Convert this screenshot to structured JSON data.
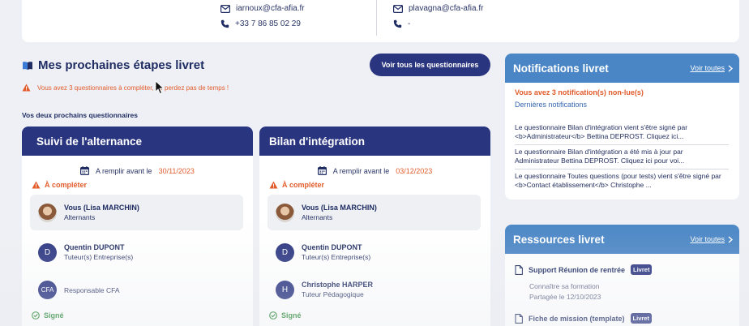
{
  "contacts": {
    "left": {
      "email": "iarnoux@cfa-afia.fr",
      "phone": "+33 7 86 85 02 29"
    },
    "right": {
      "email": "plavagna@cfa-afia.fr",
      "phone": "-"
    }
  },
  "section": {
    "title": "Mes prochaines étapes livret",
    "view_all_label": "Voir tous les questionnaires",
    "warning": "Vous avez 3 questionnaires à compléter, ne perdez pas de temps !",
    "subtitle": "Vos deux prochains questionnaires"
  },
  "questionnaires": [
    {
      "title": "Suivi de l'alternance",
      "date_label": "A remplir avant le",
      "date": "30/11/2023",
      "status": "À compléter",
      "participants": [
        {
          "name": "Vous (Lisa MARCHIN)",
          "role": "Alternants",
          "avatar": "photo"
        },
        {
          "name": "Quentin DUPONT",
          "role": "Tuteur(s) Entreprise(s)",
          "avatar": "D"
        },
        {
          "name": "",
          "role": "Responsable CFA",
          "avatar": "CFA"
        }
      ],
      "footer_status": "Signé"
    },
    {
      "title": "Bilan d'intégration",
      "date_label": "A remplir avant le",
      "date": "03/12/2023",
      "status": "À compléter",
      "participants": [
        {
          "name": "Vous (Lisa MARCHIN)",
          "role": "Alternants",
          "avatar": "photo"
        },
        {
          "name": "Quentin DUPONT",
          "role": "Tuteur(s) Entreprise(s)",
          "avatar": "D"
        },
        {
          "name": "Christophe HARPER",
          "role": "Tuteur Pédagogique",
          "avatar": "H"
        }
      ],
      "footer_status": "Signé"
    }
  ],
  "notifications": {
    "title": "Notifications livret",
    "link": "Voir toutes",
    "count_text": "Vous avez 3 notification(s) non-lue(s)",
    "recent_label": "Dernières notifications",
    "items": [
      "Le questionnaire Bilan d'intégration vient s'être signé par <b>Administrateur</b> Bettina DEPROST. Cliquez ici...",
      "Le questionnaire Bilan d'intégration a été mis à jour par Administrateur Bettina DEPROST. Cliquez ici pour voi...",
      "Le questionnaire Toutes questions (pour tests) vient s'être signé par <b>Contact établissement</b> Christophe ..."
    ]
  },
  "resources": {
    "title": "Ressources livret",
    "link": "Voir toutes",
    "items": [
      {
        "title": "Support Réunion de rentrée",
        "badge": "Livret",
        "desc": "Connaître sa formation",
        "date": "Partagée le 12/10/2023"
      },
      {
        "title": "Fiche de mission (template)",
        "badge": "Livret"
      }
    ]
  },
  "colors": {
    "primary": "#2a3580",
    "accent": "#e25c2c",
    "panel_header": "#4a86c5",
    "success": "#2e8b3a"
  }
}
